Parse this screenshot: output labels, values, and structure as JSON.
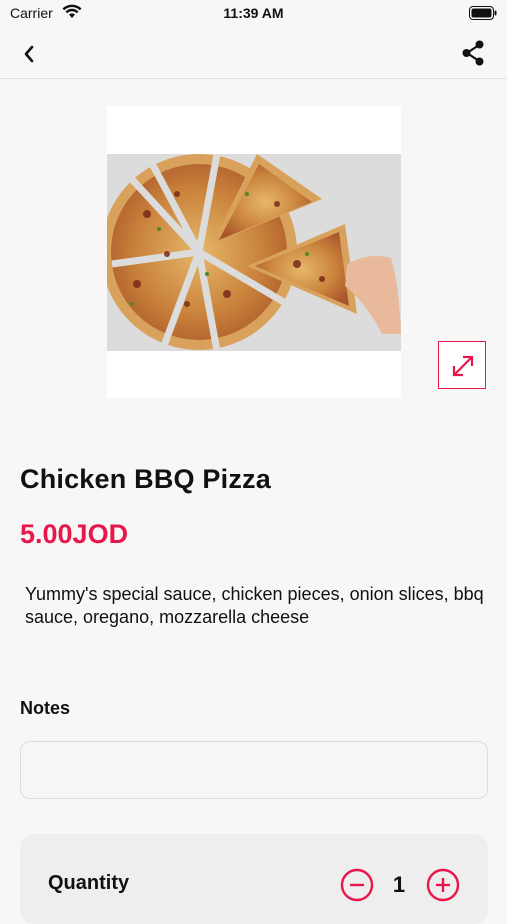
{
  "status_bar": {
    "carrier": "Carrier",
    "time": "11:39 AM"
  },
  "nav": {
    "back_icon": "chevron-left-icon",
    "share_icon": "share-icon"
  },
  "product": {
    "image_alt": "Chicken BBQ pizza slices",
    "expand_icon": "expand-icon",
    "name": "Chicken BBQ Pizza",
    "price": "5.00JOD",
    "description": "Yummy's special sauce, chicken pieces, onion slices, bbq sauce, oregano, mozzarella cheese"
  },
  "notes": {
    "label": "Notes",
    "value": "",
    "placeholder": ""
  },
  "quantity": {
    "label": "Quantity",
    "value": "1"
  },
  "colors": {
    "accent": "#e8174b",
    "background": "#f7f7f7"
  }
}
